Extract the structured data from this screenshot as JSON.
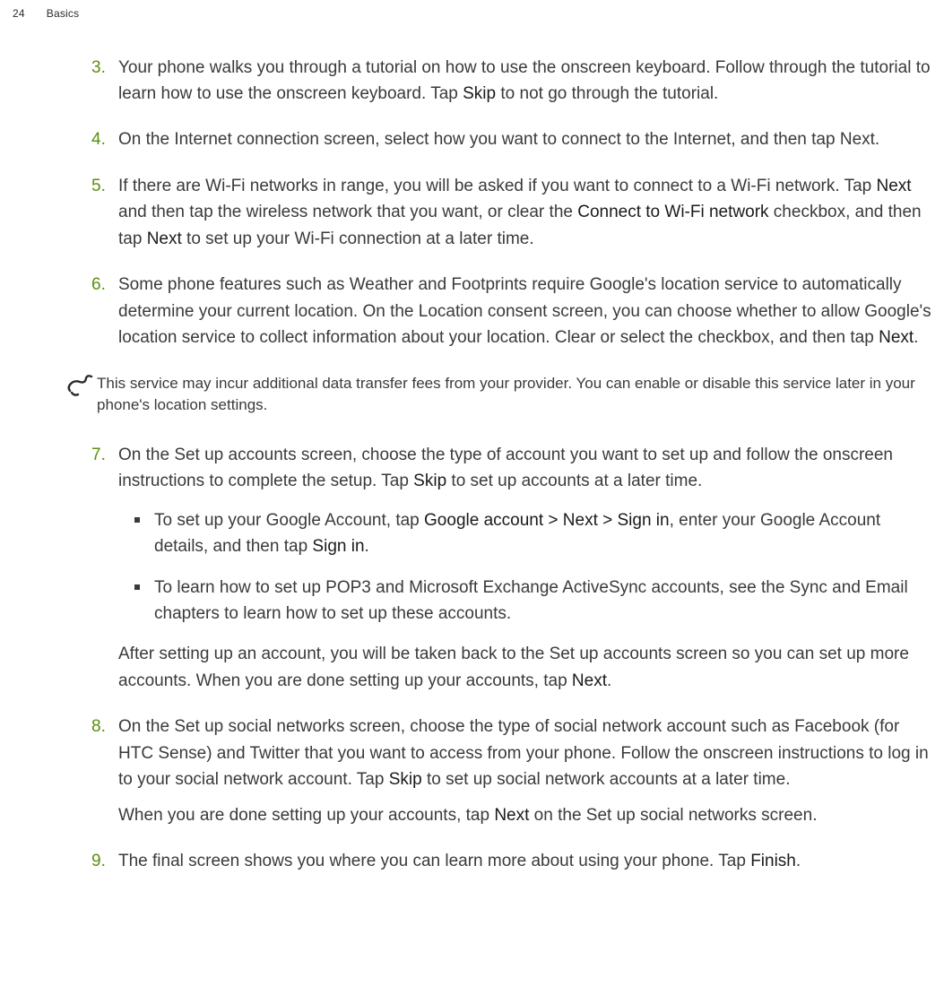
{
  "header": {
    "page_number": "24",
    "section": "Basics"
  },
  "steps": {
    "s3": {
      "num": "3.",
      "t1": "Your phone walks you through a tutorial on how to use the onscreen keyboard. Follow through the tutorial to learn how to use the onscreen keyboard. Tap ",
      "b1": "Skip",
      "t2": " to not go through the tutorial."
    },
    "s4": {
      "num": "4.",
      "t1": "On the Internet connection screen, select how you want to connect to the Internet, and then tap Next."
    },
    "s5": {
      "num": "5.",
      "t1": "If there are Wi-Fi networks in range, you will be asked if you want to connect to a Wi-Fi network. Tap ",
      "b1": "Next",
      "t2": " and then tap the wireless network that you want, or clear the ",
      "b2": "Connect to Wi-Fi network",
      "t3": " checkbox, and then tap ",
      "b3": "Next",
      "t4": " to set up your Wi-Fi connection at a later time."
    },
    "s6": {
      "num": "6.",
      "t1": "Some phone features such as Weather and Footprints require Google's location service to automatically determine your current location. On the Location consent screen, you can choose whether to allow Google's location service to collect information about your location. Clear or select the checkbox, and then tap ",
      "b1": "Next",
      "t2": "."
    },
    "s7": {
      "num": "7.",
      "t1": "On the Set up accounts screen, choose the type of account you want to set up and follow the onscreen instructions to complete the setup. Tap ",
      "b1": "Skip",
      "t2": " to set up accounts at a later time.",
      "sub_a": {
        "t1": "To set up your Google Account, tap ",
        "b1": "Google account > Next > Sign in",
        "t2": ", enter your Google Account details, and then tap ",
        "b2": "Sign in",
        "t3": "."
      },
      "sub_b": {
        "t1": "To learn how to set up POP3 and Microsoft Exchange ActiveSync accounts, see the Sync and Email chapters to learn how to set up these accounts."
      },
      "after_t1": "After setting up an account, you will be taken back to the Set up accounts screen so you can set up more accounts. When you are done setting up your accounts, tap ",
      "after_b1": "Next",
      "after_t2": "."
    },
    "s8": {
      "num": "8.",
      "t1": "On the Set up social networks screen, choose the type of social network account such as Facebook (for HTC Sense) and Twitter that you want to access from your phone. Follow the onscreen instructions to log in to your social network account. Tap ",
      "b1": "Skip",
      "t2": " to set up social network accounts at a later time.",
      "after_t1": "When you are done setting up your accounts, tap ",
      "after_b1": "Next",
      "after_t2": " on the Set up social networks screen."
    },
    "s9": {
      "num": "9.",
      "t1": "The final screen shows you where you can learn more about using your phone. Tap ",
      "b1": "Finish",
      "t2": "."
    }
  },
  "note": {
    "text": "This service may incur additional data transfer fees from your provider. You can enable or disable this service later in your phone's location settings."
  }
}
